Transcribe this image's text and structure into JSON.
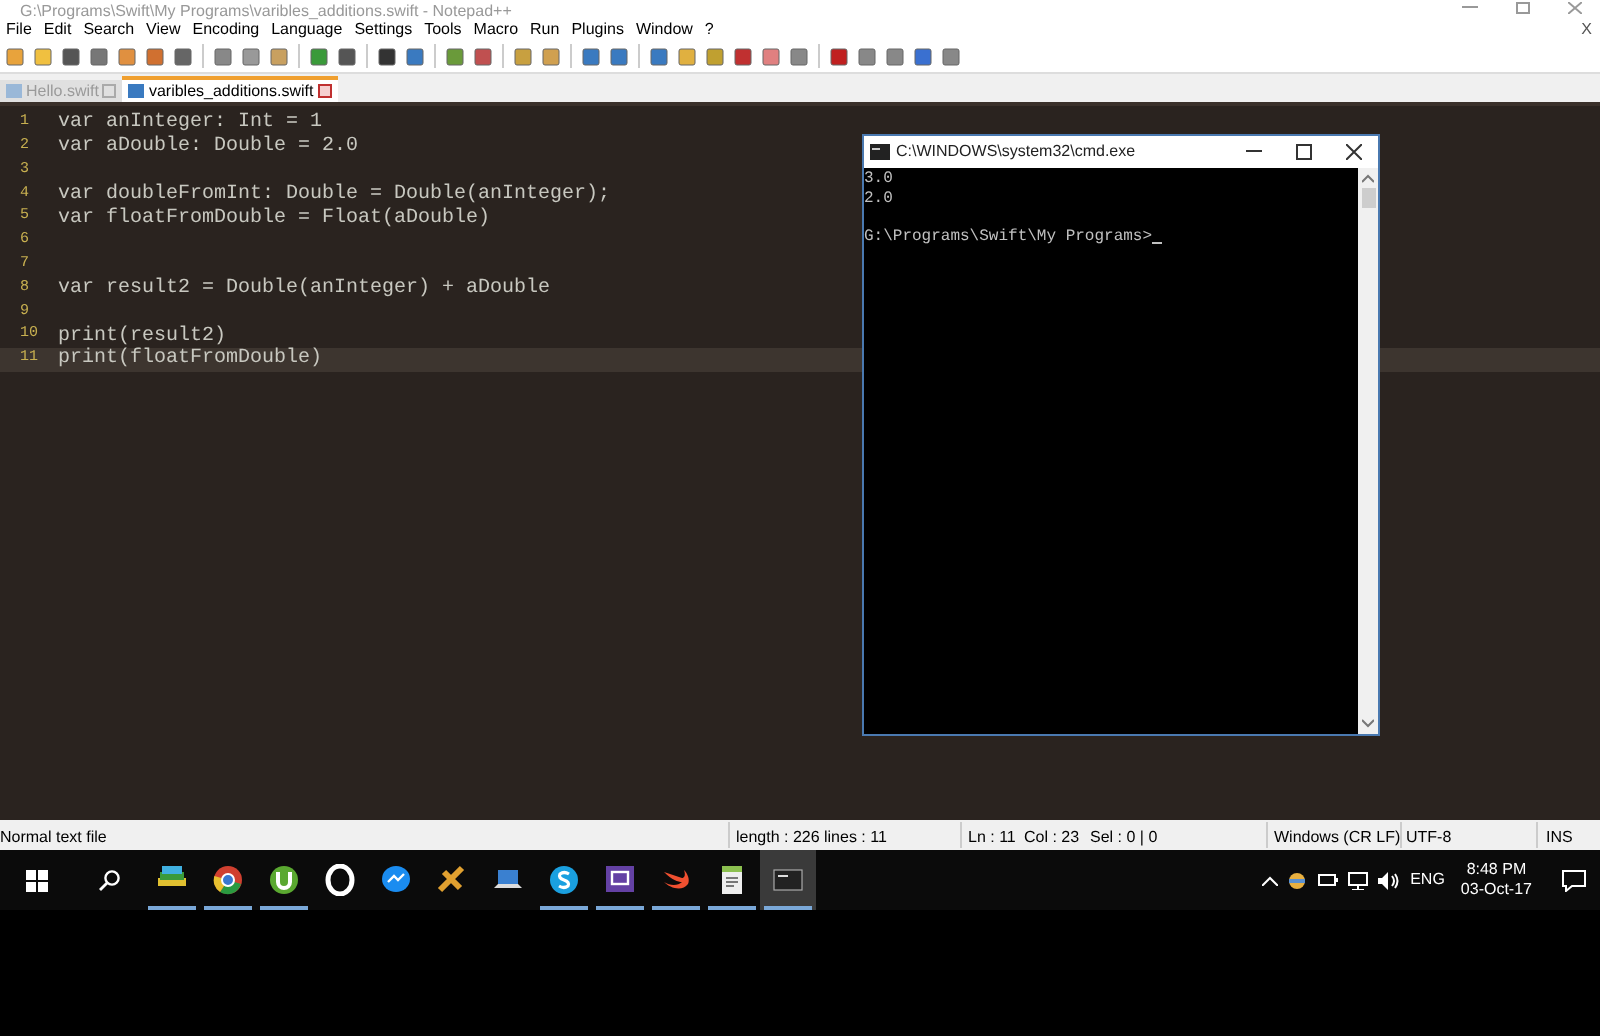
{
  "window": {
    "title": "G:\\Programs\\Swift\\My Programs\\varibles_additions.swift - Notepad++"
  },
  "menu": [
    "File",
    "Edit",
    "Search",
    "View",
    "Encoding",
    "Language",
    "Settings",
    "Tools",
    "Macro",
    "Run",
    "Plugins",
    "Window",
    "?"
  ],
  "menu_close": "X",
  "tabs": [
    {
      "label": "Hello.swift",
      "selected": false
    },
    {
      "label": "varibles_additions.swift",
      "selected": true
    }
  ],
  "editor": {
    "lines": [
      {
        "number": "1",
        "text": "var anInteger: Int = 1",
        "current": false
      },
      {
        "number": "2",
        "text": "var aDouble: Double = 2.0",
        "current": false
      },
      {
        "number": "3",
        "current": false
      },
      {
        "number": "4",
        "text": "var doubleFromInt: Double = Double(anInteger);",
        "current": false
      },
      {
        "number": "5",
        "text": "var floatFromDouble = Float(aDouble)",
        "current": false
      },
      {
        "number": "6",
        "current": false
      },
      {
        "number": "7",
        "current": false
      },
      {
        "number": "8",
        "text": "var result2 = Double(anInteger) + aDouble",
        "current": false
      },
      {
        "number": "9",
        "current": false
      },
      {
        "number": "10",
        "text": "print(result2)",
        "current": false
      },
      {
        "number": "11",
        "text": "print(floatFromDouble)",
        "current": true
      }
    ]
  },
  "console": {
    "title": "C:\\WINDOWS\\system32\\cmd.exe",
    "output": [
      "3.0",
      "2.0"
    ],
    "prompt": "G:\\Programs\\Swift\\My Programs>"
  },
  "status_bar": {
    "file_type": "Normal text file",
    "length": "length : 226",
    "lines": "lines : 11",
    "position": "Ln : 11",
    "column": "Col : 23",
    "selection": "Sel : 0 | 0",
    "eol": "Windows (CR LF)",
    "encoding": "UTF-8",
    "mode": "INS"
  },
  "taskbar": {
    "apps": [
      {
        "kind": "stack",
        "running": true,
        "selected": false
      },
      {
        "kind": "chrome",
        "running": true,
        "selected": false
      },
      {
        "kind": "torrent",
        "running": true,
        "selected": false
      },
      {
        "kind": "opera",
        "running": false,
        "selected": false
      },
      {
        "kind": "messenger",
        "running": false,
        "selected": false
      },
      {
        "kind": "tool",
        "running": false,
        "selected": false
      },
      {
        "kind": "laptop",
        "running": false,
        "selected": false
      },
      {
        "kind": "skype",
        "running": true,
        "selected": false
      },
      {
        "kind": "twitch",
        "running": true,
        "selected": false
      },
      {
        "kind": "swift",
        "running": true,
        "selected": false
      },
      {
        "kind": "notepad",
        "running": true,
        "selected": false
      },
      {
        "kind": "console",
        "running": true,
        "selected": true
      }
    ],
    "language": "ENG",
    "time": "8:48 PM",
    "date": "03-Oct-17"
  }
}
